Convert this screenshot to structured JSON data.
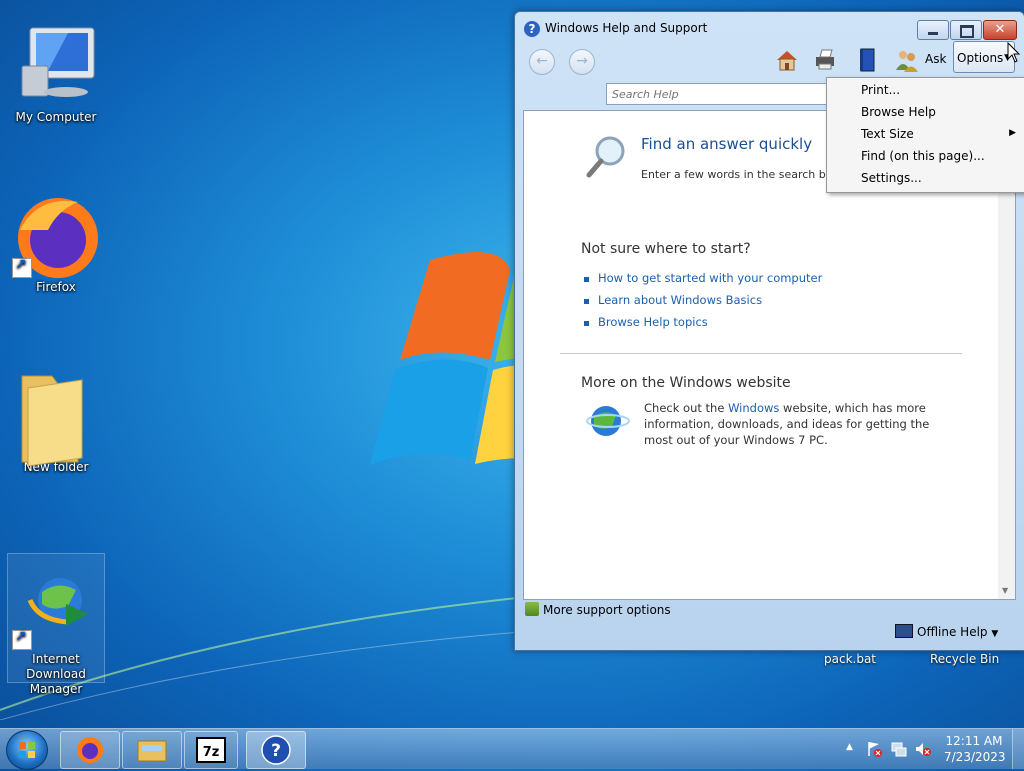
{
  "desktop": {
    "icons": [
      {
        "label": "My Computer"
      },
      {
        "label": "Firefox"
      },
      {
        "label": "New folder"
      },
      {
        "label": "Internet Download Manager"
      }
    ],
    "right_labels": [
      "pack.bat",
      "Recycle Bin"
    ]
  },
  "help_window": {
    "title": "Windows Help and Support",
    "toolbar": {
      "ask_label": "Ask",
      "options_label": "Options"
    },
    "search": {
      "placeholder": "Search Help"
    },
    "content": {
      "find_title": "Find an answer quickly",
      "find_subtitle": "Enter a few words in the search box",
      "start_heading": "Not sure where to start?",
      "links": [
        "How to get started with your computer",
        "Learn about Windows Basics",
        "Browse Help topics"
      ],
      "more_heading": "More on the Windows website",
      "checkout_pre": "Check out the ",
      "checkout_link": "Windows",
      "checkout_post": " website, which has more information, downloads, and ideas for getting the most out of your Windows 7 PC."
    },
    "footer": {
      "more_support": "More support options",
      "offline_help": "Offline Help"
    }
  },
  "options_menu": {
    "items": [
      "Print...",
      "Browse Help",
      "Text Size",
      "Find (on this page)...",
      "Settings..."
    ]
  },
  "taskbar": {
    "clock_time": "12:11 AM",
    "clock_date": "7/23/2023"
  }
}
